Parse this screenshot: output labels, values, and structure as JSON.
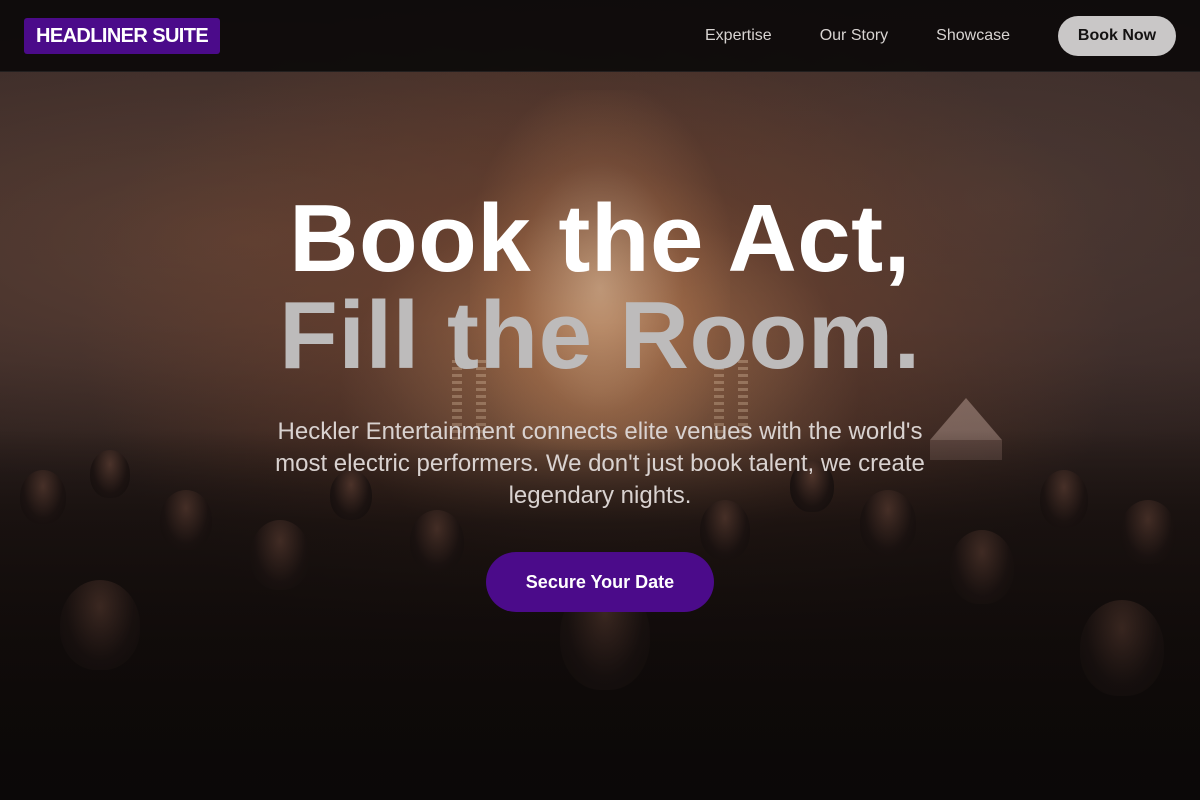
{
  "brand": {
    "logo_text": "HEADLINER SUITE",
    "accent_color": "#4b0b8a"
  },
  "nav": {
    "links": [
      "Expertise",
      "Our Story",
      "Showcase"
    ],
    "book_button": "Book Now"
  },
  "hero": {
    "headline_line1": "Book the Act,",
    "headline_line2": "Fill the Room.",
    "subtitle": "Heckler Entertainment connects elite venues with the world's most electric performers. We don't just book talent, we create legendary nights.",
    "cta_label": "Secure Your Date",
    "background_image": "concert-crowd-photo"
  }
}
